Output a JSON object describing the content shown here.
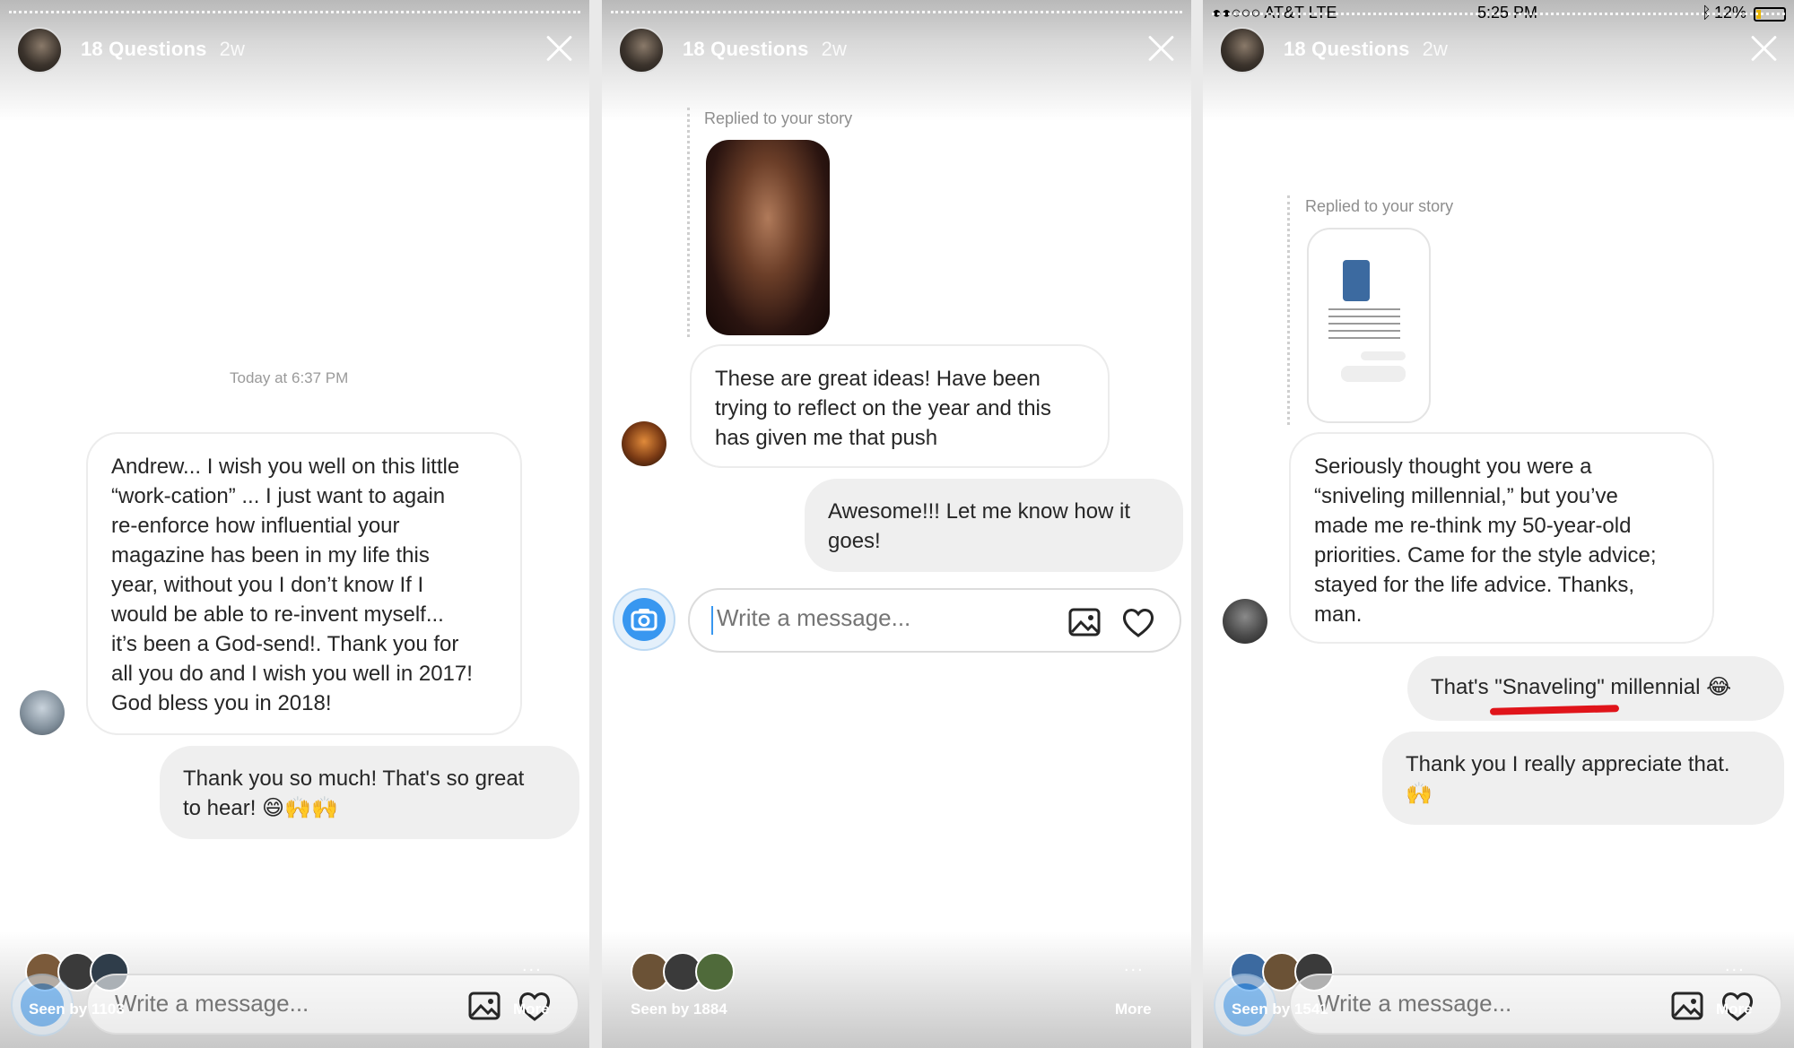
{
  "panels": [
    {
      "story_title": "18 Questions",
      "story_age": "2w",
      "timestamp": "Today at 6:37 PM",
      "message_in": "Andrew... I wish you well on this little\n“work-cation” ... I just want to again\nre-enforce how influential your\nmagazine has been in my life this\nyear, without you I don’t know If I\nwould be able to re-invent myself...\nit’s been a God-send!.  Thank you for\nall you do and I wish you well in 2017!\nGod bless you in 2018!",
      "message_out": "Thank you so much! That's so great\nto hear! 😄🙌🙌",
      "seen_by": "Seen by 1103",
      "more_label": "More",
      "compose_placeholder": "Write a message..."
    },
    {
      "story_title": "18 Questions",
      "story_age": "2w",
      "replied_label": "Replied to your story",
      "message_in": "These are great ideas! Have been\ntrying to reflect on the year and this\nhas given me that push",
      "message_out": "Awesome!!! Let me know how it\ngoes!",
      "compose_placeholder": "Write a message...",
      "seen_by": "Seen by 1884",
      "more_label": "More",
      "more_dots": "..."
    },
    {
      "status_carrier": "●●○○○ AT&T  LTE",
      "status_time": "5:25 PM",
      "status_battery": "12%",
      "story_title": "18 Questions",
      "story_age": "2w",
      "replied_label": "Replied to your story",
      "message_in": "Seriously thought you were a\n“sniveling millennial,” but you’ve\nmade me re-think my 50-year-old\npriorities. Came for the style advice;\nstayed for the life advice. Thanks,\nman.",
      "message_out_1": "That's \"Snaveling\" millennial 😂",
      "message_out_2": "Thank you I really appreciate that.\n🙌",
      "seen_by": "Seen by 1541",
      "more_label": "More",
      "compose_placeholder": "Write a message..."
    }
  ],
  "colors": {
    "accent_blue": "#3897f0",
    "bubble_out": "#efefef",
    "annotation_red": "#e0141a"
  },
  "icons": [
    "close-icon",
    "camera-icon",
    "image-icon",
    "heart-icon"
  ]
}
